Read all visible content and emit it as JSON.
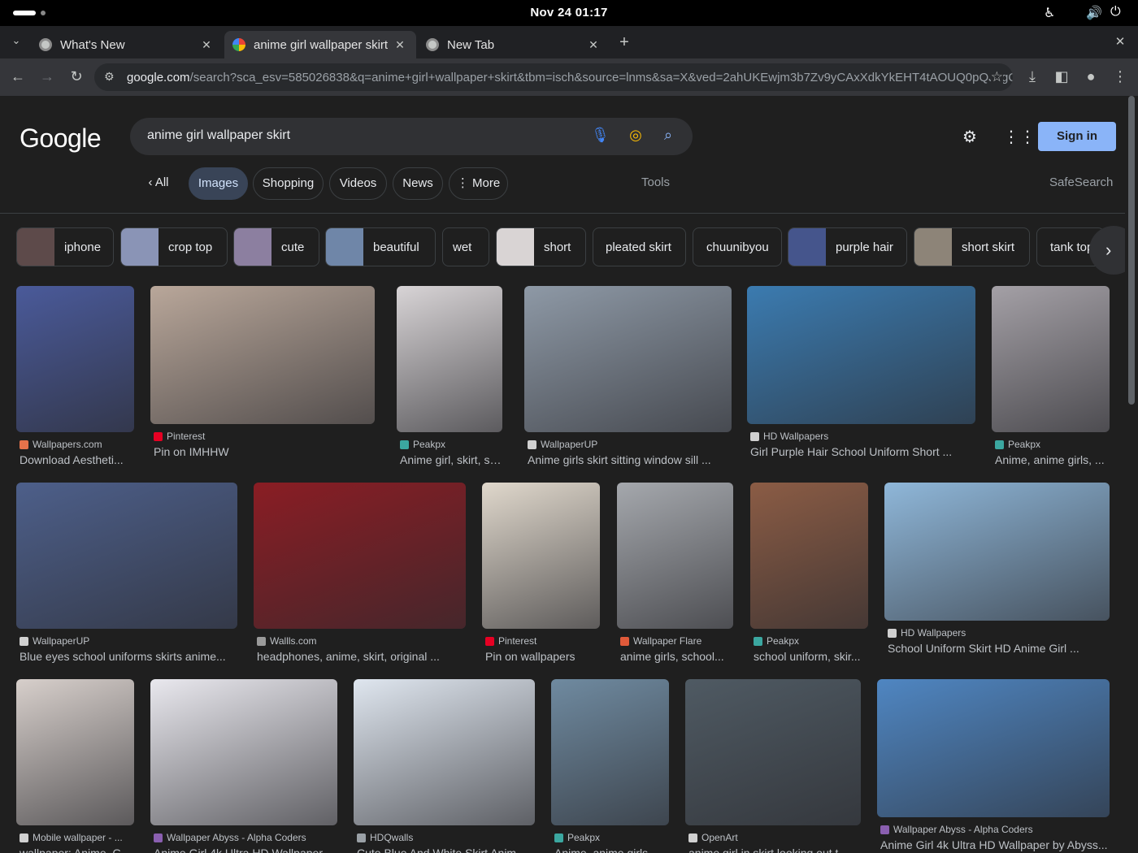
{
  "system_bar": {
    "clock": "Nov 24  01:17"
  },
  "browser": {
    "tabs": [
      {
        "title": "What's New"
      },
      {
        "title": "anime girl wallpaper skirt"
      },
      {
        "title": "New Tab"
      }
    ],
    "url_host": "google.com",
    "url_path": "/search?sca_esv=585026838&q=anime+girl+wallpaper+skirt&tbm=isch&source=lnms&sa=X&ved=2ahUKEwjm3b7Zv9yCAxXdkYkEHT4tAOUQ0pQJegQIDx..."
  },
  "google": {
    "logo": "Google",
    "query": "anime girl wallpaper skirt",
    "sign_in": "Sign in",
    "nav": {
      "all": "All",
      "images": "Images",
      "shopping": "Shopping",
      "videos": "Videos",
      "news": "News",
      "more": "More",
      "tools": "Tools",
      "safesearch": "SafeSearch"
    },
    "chips": [
      "iphone",
      "crop top",
      "cute",
      "beautiful",
      "wet",
      "short",
      "pleated skirt",
      "chuunibyou",
      "purple hair",
      "short skirt",
      "tank top"
    ]
  },
  "results": [
    {
      "source": "Wallpapers.com",
      "title": "Download Aestheti...",
      "color": "#4a5a9a"
    },
    {
      "source": "Pinterest",
      "title": "Pin on IMHHW",
      "color": "#b9a79a"
    },
    {
      "source": "Peakpx",
      "title": "Anime girl, skirt, sm...",
      "color": "#d8d4d6"
    },
    {
      "source": "WallpaperUP",
      "title": "Anime girls skirt sitting window sill ...",
      "color": "#8e99a6"
    },
    {
      "source": "HD Wallpapers",
      "title": "Girl Purple Hair School Uniform Short ...",
      "color": "#3b7bb0"
    },
    {
      "source": "Peakpx",
      "title": "Anime, anime girls, ...",
      "color": "#a4a0a6"
    },
    {
      "source": "WallpaperUP",
      "title": "Blue eyes school uniforms skirts anime...",
      "color": "#4d5f8a"
    },
    {
      "source": "Wallls.com",
      "title": "headphones, anime, skirt, original ...",
      "color": "#8a1d24"
    },
    {
      "source": "Pinterest",
      "title": "Pin on wallpapers",
      "color": "#e0d8cc"
    },
    {
      "source": "Wallpaper Flare",
      "title": "anime girls, school...",
      "color": "#a5a8ad"
    },
    {
      "source": "Peakpx",
      "title": "school uniform, skir...",
      "color": "#8b5c45"
    },
    {
      "source": "HD Wallpapers",
      "title": "School Uniform Skirt HD Anime Girl ...",
      "color": "#8fb7d9"
    },
    {
      "source": "Mobile wallpaper - ...",
      "title": "wallpaper: Anime, G...",
      "color": "#d7cfcb"
    },
    {
      "source": "Wallpaper Abyss - Alpha Coders",
      "title": "Anime Girl 4k Ultra HD Wallpaper ...",
      "color": "#e9e8ee"
    },
    {
      "source": "HDQwalls",
      "title": "Cute Blue And White Skirt Anim...",
      "color": "#dfe6ef"
    },
    {
      "source": "Peakpx",
      "title": "Anime, anime girls, ...",
      "color": "#6f8aa0"
    },
    {
      "source": "OpenArt",
      "title": "anime girl in skirt looking out t...",
      "color": "#4f5a63"
    },
    {
      "source": "Wallpaper Abyss - Alpha Coders",
      "title": "Anime Girl 4k Ultra HD Wallpaper by Abyss...",
      "color": "#4f86c2"
    }
  ]
}
